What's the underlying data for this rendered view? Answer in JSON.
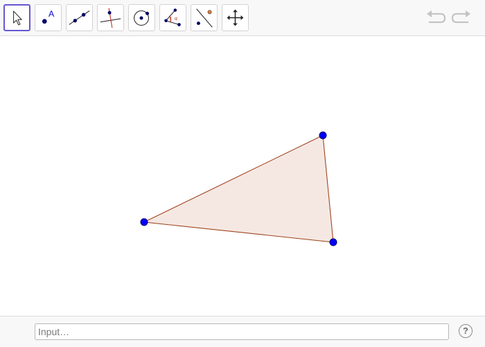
{
  "colors": {
    "accent": "#6557d2",
    "point": "#0000ff",
    "point_outline": "#000066",
    "polygon_fill": "#f5e8e3",
    "polygon_stroke": "#a0451f",
    "tool_icon": "#333333"
  },
  "toolbar": {
    "tools": [
      {
        "name": "move-tool",
        "icon": "arrow-pointer-icon",
        "selected": true
      },
      {
        "name": "point-tool",
        "icon": "point-icon",
        "label": "A"
      },
      {
        "name": "line-tool",
        "icon": "line-through-points-icon"
      },
      {
        "name": "perpendicular-line-tool",
        "icon": "perpendicular-line-icon"
      },
      {
        "name": "circle-tool",
        "icon": "circle-center-point-icon"
      },
      {
        "name": "angle-tool",
        "icon": "angle-icon",
        "label": "α"
      },
      {
        "name": "reflect-tool",
        "icon": "reflect-about-line-icon"
      },
      {
        "name": "move-graphics-view-tool",
        "icon": "move-arrows-icon"
      }
    ],
    "undo_icon": "undo-icon",
    "redo_icon": "redo-icon"
  },
  "graphics": {
    "polygon": {
      "name": "triangle",
      "vertices": [
        {
          "name": "vertex-left"
        },
        {
          "name": "vertex-top"
        },
        {
          "name": "vertex-bottom"
        }
      ]
    }
  },
  "input_bar": {
    "placeholder": "Input…",
    "help_label": "?"
  }
}
